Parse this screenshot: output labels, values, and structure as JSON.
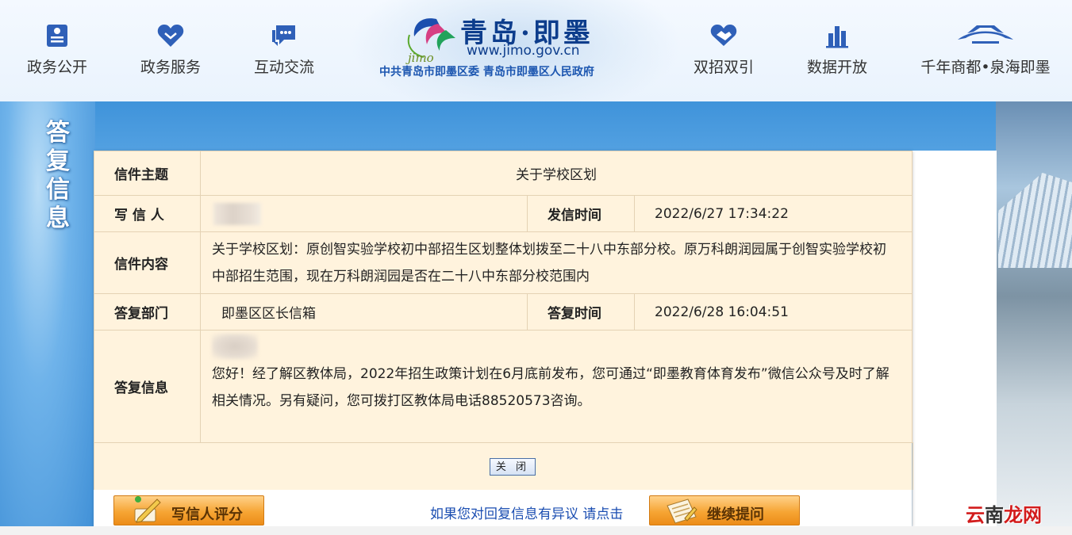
{
  "nav": {
    "left": [
      {
        "label": "政务公开",
        "icon": "document-icon"
      },
      {
        "label": "政务服务",
        "icon": "heart-icon"
      },
      {
        "label": "互动交流",
        "icon": "chat-icon"
      }
    ],
    "right": [
      {
        "label": "双招双引",
        "icon": "handshake-icon"
      },
      {
        "label": "数据开放",
        "icon": "bar-chart-icon"
      },
      {
        "label": "千年商都•泉海即墨",
        "icon": "pavilion-icon"
      }
    ]
  },
  "logo": {
    "site_name": "青岛·即墨",
    "mark_text": "jimo",
    "url": "www.jimo.gov.cn",
    "subtitle": "中共青岛市即墨区委  青岛市即墨区人民政府"
  },
  "side_title": "答复信息",
  "letter": {
    "subject_label": "信件主题",
    "subject": "关于学校区划",
    "writer_label": "写 信 人",
    "sent_time_label": "发信时间",
    "sent_time": "2022/6/27 17:34:22",
    "content_label": "信件内容",
    "content": "关于学校区划：原创智实验学校初中部招生区划整体划拨至二十八中东部分校。原万科朗润园属于创智实验学校初中部招生范围，现在万科朗润园是否在二十八中东部分校范围内",
    "dept_label": "答复部门",
    "dept": "即墨区区长信箱",
    "reply_time_label": "答复时间",
    "reply_time": "2022/6/28 16:04:51",
    "reply_label": "答复信息",
    "reply": "您好！经了解区教体局，2022年招生政策计划在6月底前发布，您可通过“即墨教育体育发布”微信公众号及时了解相关情况。另有疑问，您可拨打区教体局电话88520573咨询。"
  },
  "actions": {
    "close": "关 闭",
    "rate": "写信人评分",
    "dispute": "如果您对回复信息有异议 请点击",
    "ask": "继续提问"
  },
  "watermark": {
    "a": "云",
    "b": "南",
    "c": "龙网"
  },
  "colors": {
    "label_blue": "#1a4db1",
    "card_bg": "#fff3dd",
    "button_orange": "#f6a534"
  }
}
